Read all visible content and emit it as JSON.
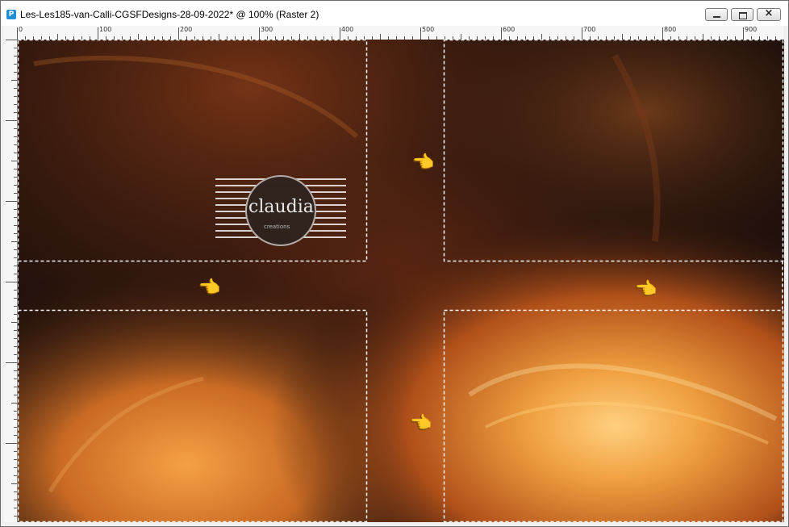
{
  "window": {
    "title": "Les-Les185-van-Calli-CGSFDesigns-28-09-2022* @ 100% (Raster 2)",
    "app_icon_glyph": "P",
    "buttons": {
      "minimize": "minimize-icon",
      "maximize": "maximize-icon",
      "close": "close-icon"
    }
  },
  "rulers": {
    "horizontal_labels": [
      "0",
      "100",
      "200",
      "300",
      "400",
      "500",
      "600",
      "700",
      "800",
      "900"
    ],
    "unit_step": 100
  },
  "canvas": {
    "watermark": {
      "text": "claudia",
      "subtext": "creations"
    },
    "selection_color": "#ffffff",
    "pointer_icon": "pointing-hand-icon",
    "colors": {
      "dark": "#1a0e0a",
      "orange": "#e07a20",
      "gold": "#f0b040",
      "brown": "#5a2a14"
    }
  }
}
